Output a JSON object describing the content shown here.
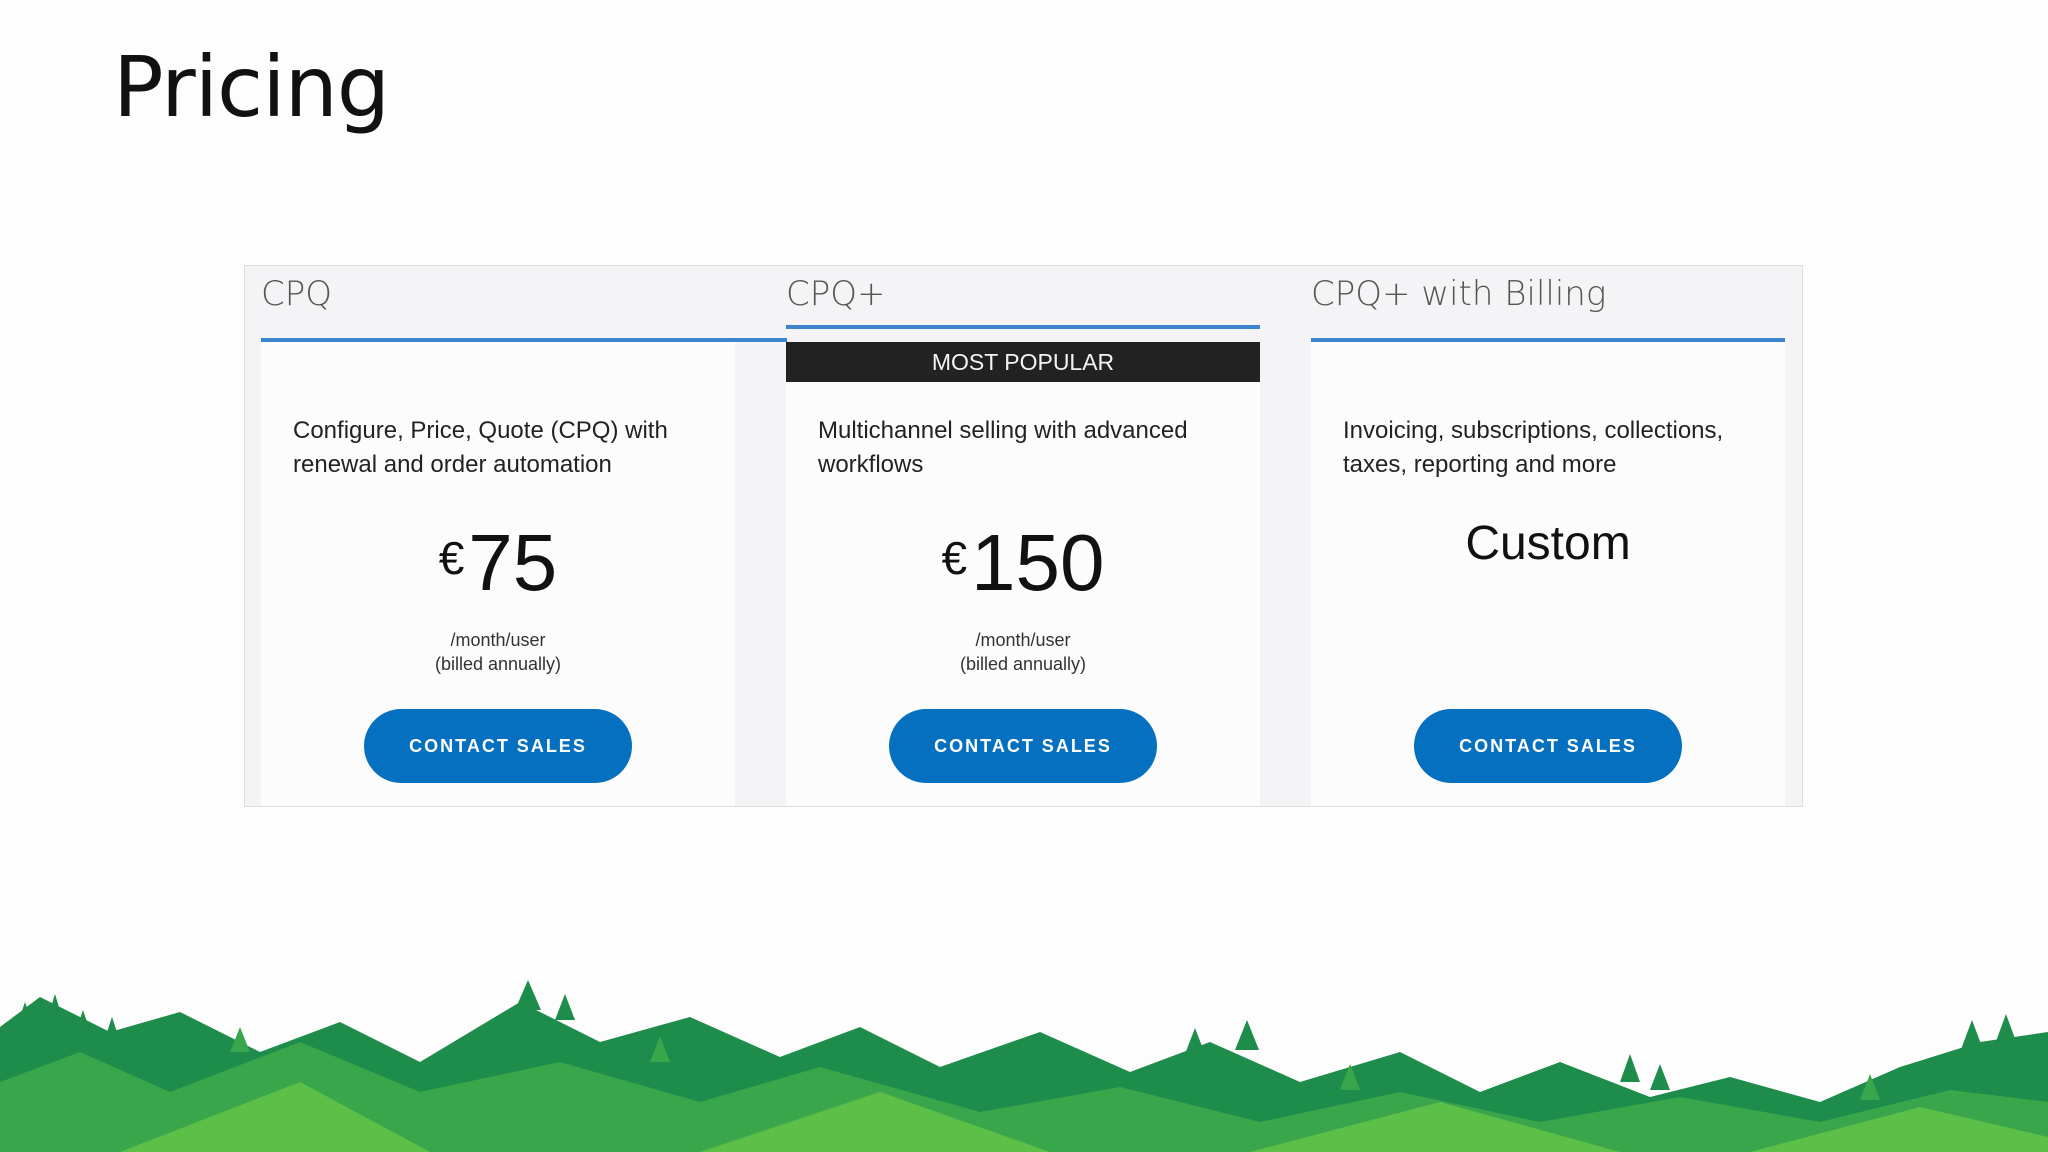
{
  "slide": {
    "title": "Pricing"
  },
  "tiers": [
    {
      "name": "CPQ",
      "badge": "",
      "description": "Configure, Price, Quote (CPQ) with renewal and order automation",
      "currency": "€",
      "price": "75",
      "period": "/month/user",
      "billing": "(billed annually)",
      "cta": "CONTACT SALES"
    },
    {
      "name": "CPQ+",
      "badge": "MOST POPULAR",
      "description": "Multichannel selling with advanced workflows",
      "currency": "€",
      "price": "150",
      "period": "/month/user",
      "billing": "(billed annually)",
      "cta": "CONTACT SALES"
    },
    {
      "name": "CPQ+ with Billing",
      "badge": "",
      "description": "Invoicing, subscriptions, collections, taxes, reporting and more",
      "price": "Custom",
      "cta": "CONTACT SALES"
    }
  ],
  "colors": {
    "accent_line": "#3d84cf",
    "button": "#0670c0",
    "badge_background": "#222222",
    "hills_dark": "#1e8c4a",
    "hills_light": "#5cbf48"
  },
  "decoration": {
    "footer_art": "forest-hills-illustration"
  }
}
